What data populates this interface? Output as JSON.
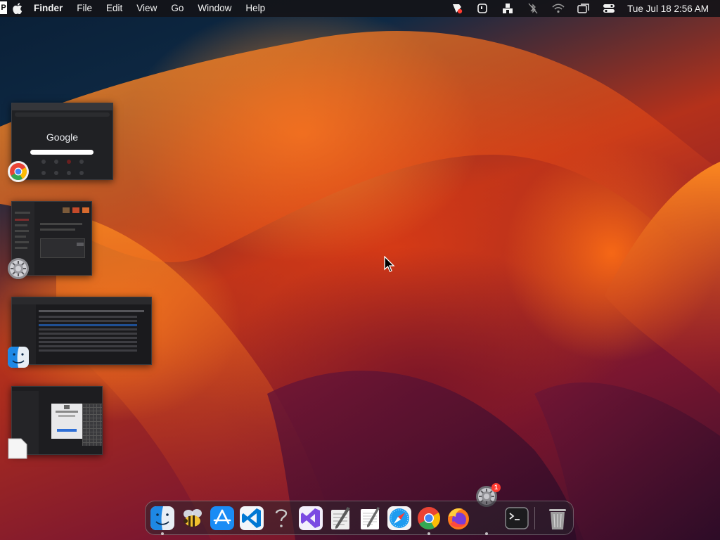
{
  "menubar": {
    "app_name": "Finder",
    "menus": [
      "File",
      "Edit",
      "View",
      "Go",
      "Window",
      "Help"
    ],
    "clock": "Tue Jul 18  2:56 AM",
    "edge_label": "P",
    "status_icons": [
      "script-editor-icon",
      "screen-capture-icon",
      "user-switch-icon",
      "bluetooth-off-icon",
      "wifi-icon",
      "window-mirror-icon",
      "control-center-icon"
    ]
  },
  "stage_manager": {
    "windows": [
      {
        "app": "Google Chrome",
        "icon": "chrome-icon",
        "content_title": "Google"
      },
      {
        "app": "System Settings",
        "icon": "system-settings-icon"
      },
      {
        "app": "Finder",
        "icon": "finder-icon"
      },
      {
        "app": "Preview",
        "icon": "document-icon"
      }
    ]
  },
  "dock": {
    "items": [
      {
        "name": "Finder",
        "icon": "finder-icon",
        "running": true
      },
      {
        "name": "Cyberduck",
        "icon": "bee-icon",
        "running": false
      },
      {
        "name": "App Store",
        "icon": "app-store-icon",
        "running": false
      },
      {
        "name": "Visual Studio Code",
        "icon": "vscode-icon",
        "running": false
      },
      {
        "name": "Help",
        "icon": "question-mark-icon",
        "running": false
      },
      {
        "name": "Visual Studio",
        "icon": "visual-studio-icon",
        "running": false
      },
      {
        "name": "Script Editor",
        "icon": "script-editor-icon",
        "running": false
      },
      {
        "name": "TextEdit",
        "icon": "textedit-icon",
        "running": false
      },
      {
        "name": "Safari",
        "icon": "safari-icon",
        "running": false
      },
      {
        "name": "Google Chrome",
        "icon": "chrome-icon",
        "running": true
      },
      {
        "name": "Firefox",
        "icon": "firefox-icon",
        "running": false
      },
      {
        "name": "System Settings",
        "icon": "system-settings-icon",
        "running": true
      },
      {
        "name": "Terminal",
        "icon": "terminal-icon",
        "running": false
      },
      {
        "name": "Trash",
        "icon": "trash-icon",
        "running": false
      }
    ],
    "settings_badge": "1"
  },
  "colors": {
    "menubar_bg": "#141418",
    "dock_bg": "#28242c",
    "badge_red": "#ff3b30",
    "finder_blue": "#1e88e5",
    "chrome_red": "#ea4335",
    "chrome_yellow": "#fbbc05",
    "chrome_green": "#34a853",
    "vscode_blue": "#0078d4",
    "vs_purple": "#7b4ae2"
  }
}
